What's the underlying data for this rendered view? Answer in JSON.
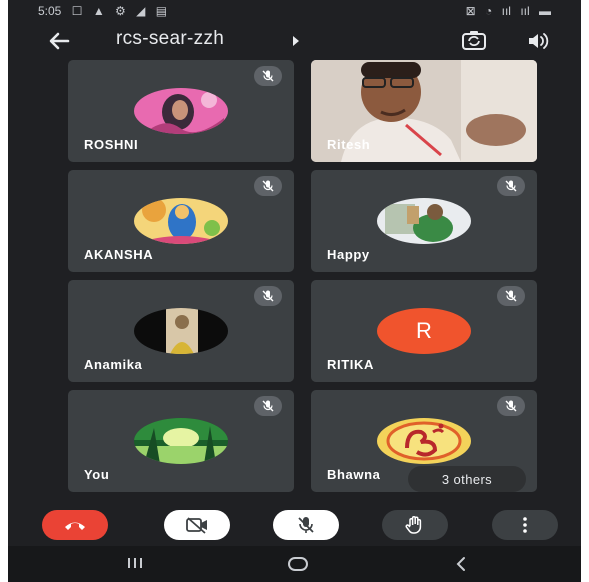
{
  "status_bar": {
    "time": "5:05",
    "left_icons": [
      "☐",
      "▲",
      "⚙",
      "◢",
      "▤"
    ],
    "right_icons": [
      "⊠",
      "◔",
      "ııl",
      "ııl",
      "▬"
    ]
  },
  "header": {
    "room_name": "rcs-sear-zzh",
    "icons": [
      "back-arrow-icon",
      "chevron-right-icon",
      "camera-flip-icon",
      "speaker-icon"
    ]
  },
  "participants": [
    {
      "name": "ROSHNI",
      "avatar": "photo",
      "muted": true,
      "colors": [
        "#e86ab0",
        "#3b2a3a",
        "#b23d7a"
      ]
    },
    {
      "name": "Ritesh",
      "avatar": "video",
      "muted": false
    },
    {
      "name": "AKANSHA",
      "avatar": "photo",
      "muted": true,
      "colors": [
        "#e9a33d",
        "#2f74c7",
        "#f4d57a"
      ]
    },
    {
      "name": "Happy",
      "avatar": "photo",
      "muted": true,
      "colors": [
        "#e9ecef",
        "#3a8a45",
        "#7a5b3e"
      ]
    },
    {
      "name": "Anamika",
      "avatar": "photo",
      "muted": true,
      "colors": [
        "#0c0c0c",
        "#d8c7a8",
        "#8a6f4c"
      ]
    },
    {
      "name": "RITIKA",
      "avatar": "letter",
      "letter": "R",
      "muted": true
    },
    {
      "name": "You",
      "avatar": "photo",
      "muted": true,
      "colors": [
        "#2e8b3c",
        "#9bd36b",
        "#1a5e2a"
      ]
    },
    {
      "name": "Bhawna",
      "avatar": "photo",
      "muted": true,
      "colors": [
        "#f3d35a",
        "#e0602a",
        "#b8282b"
      ]
    }
  ],
  "others_chip": "3 others",
  "controls": [
    "end-call",
    "camera-off",
    "mic-off",
    "raise-hand",
    "more-options"
  ],
  "colors": {
    "background": "#1f2023",
    "tile": "#3c4043",
    "end_call": "#ea4335",
    "letter_avatar": "#f0542d"
  }
}
